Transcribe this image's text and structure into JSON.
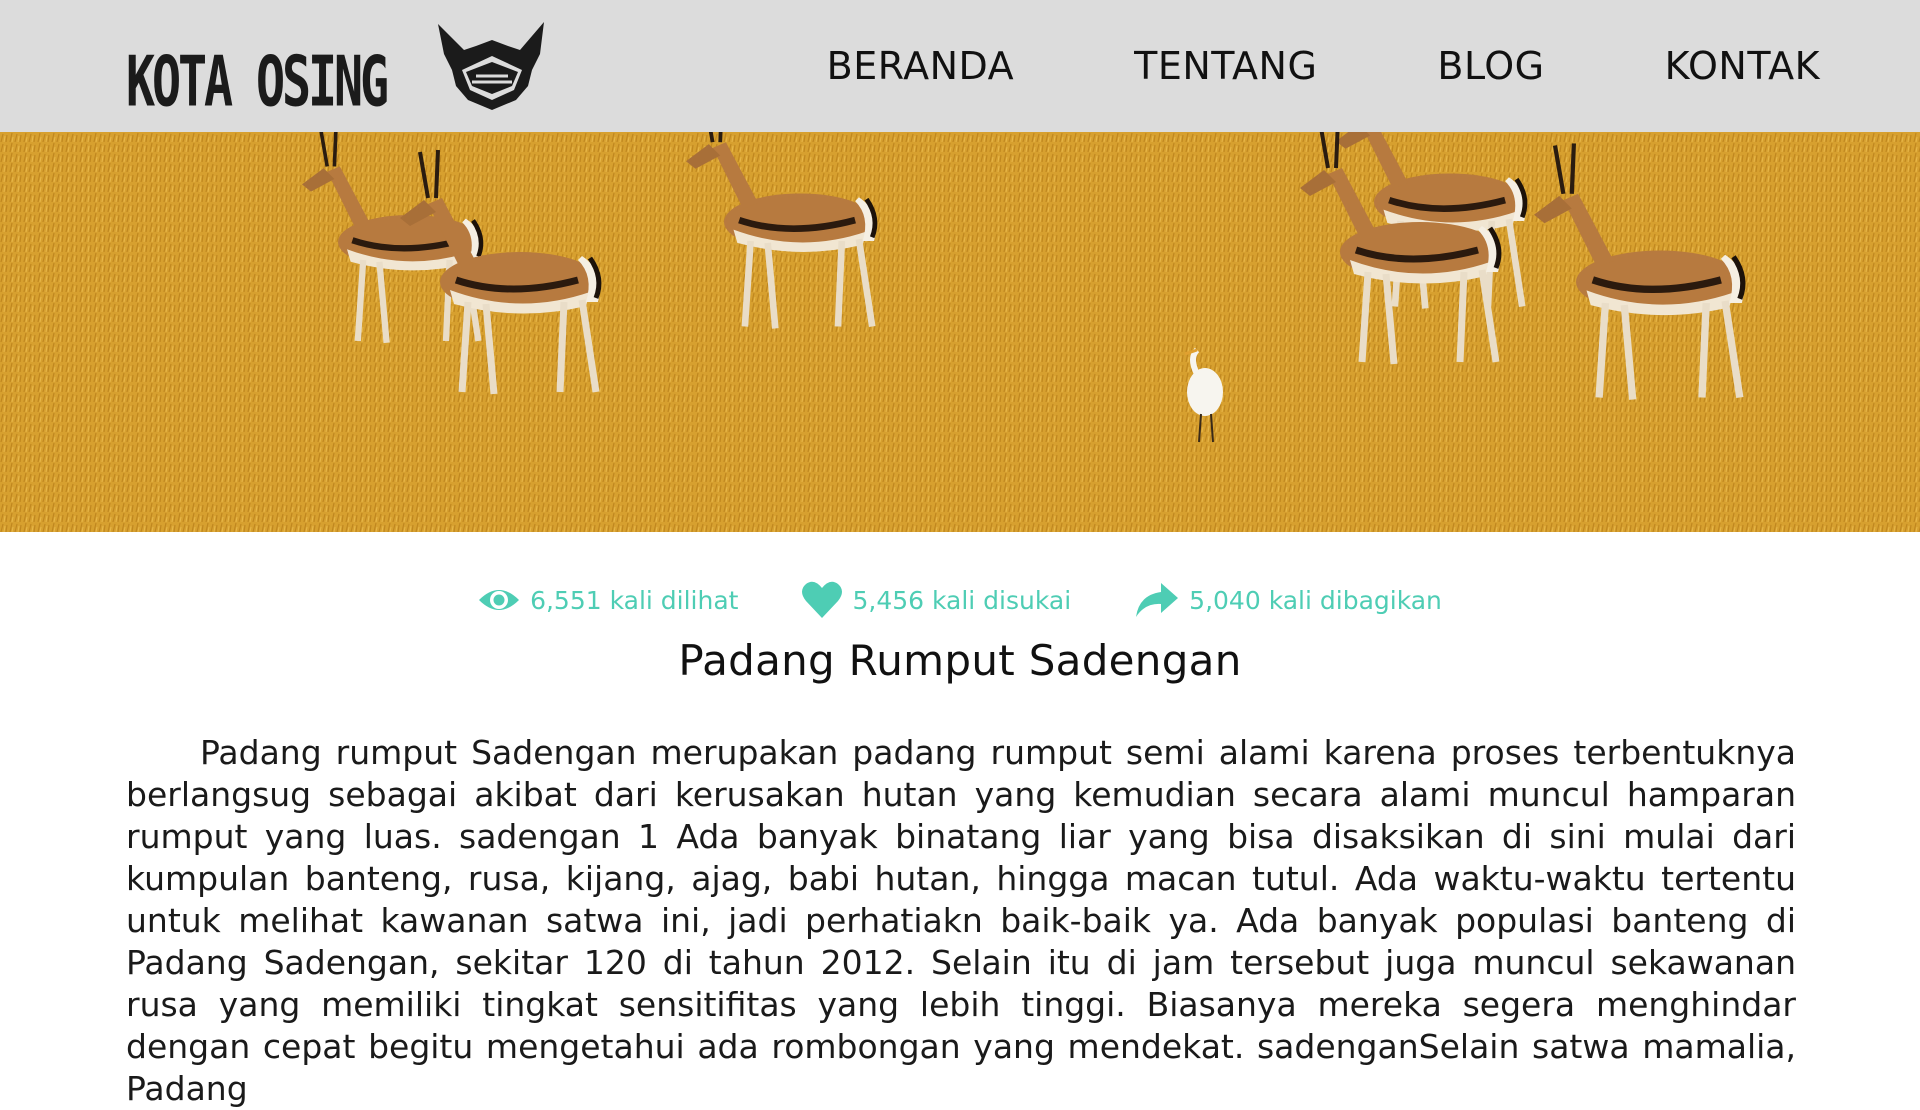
{
  "brand": {
    "name": "KOTA OSING"
  },
  "nav": {
    "items": [
      "BERANDA",
      "TENTANG",
      "BLOG",
      "KONTAK"
    ]
  },
  "hero": {
    "icon": "gazelles-savanna-photo"
  },
  "stats": {
    "views": "6,551 kali dilihat",
    "likes": "5,456 kali disukai",
    "shares": "5,040 kali dibagikan",
    "color": "#4ecdb4",
    "icons": [
      "eye-icon",
      "heart-icon",
      "share-icon"
    ]
  },
  "article": {
    "title": "Padang Rumput Sadengan",
    "body": "Padang rumput Sadengan merupakan padang rumput semi alami karena proses terbentuknya berlangsug sebagai akibat dari kerusakan hutan yang kemudian secara alami muncul hamparan rumput yang luas. sadengan 1 Ada banyak binatang liar yang bisa disaksikan di sini mulai dari kumpulan banteng, rusa, kijang, ajag, babi hutan, hingga macan tutul. Ada waktu-waktu tertentu untuk melihat kawanan satwa ini, jadi perhatiakn baik-baik ya. Ada banyak populasi banteng di Padang Sadengan, sekitar 120 di tahun 2012. Selain itu di jam tersebut juga muncul sekawanan rusa yang memiliki tingkat sensitifitas yang lebih tinggi. Biasanya mereka segera menghindar dengan cepat begitu mengetahui ada rombongan yang mendekat. sadenganSelain satwa mamalia, Padang"
  },
  "colors": {
    "header_bg": "#dcdcdc",
    "accent": "#4ecdb4",
    "savanna": "#d9a12e"
  }
}
